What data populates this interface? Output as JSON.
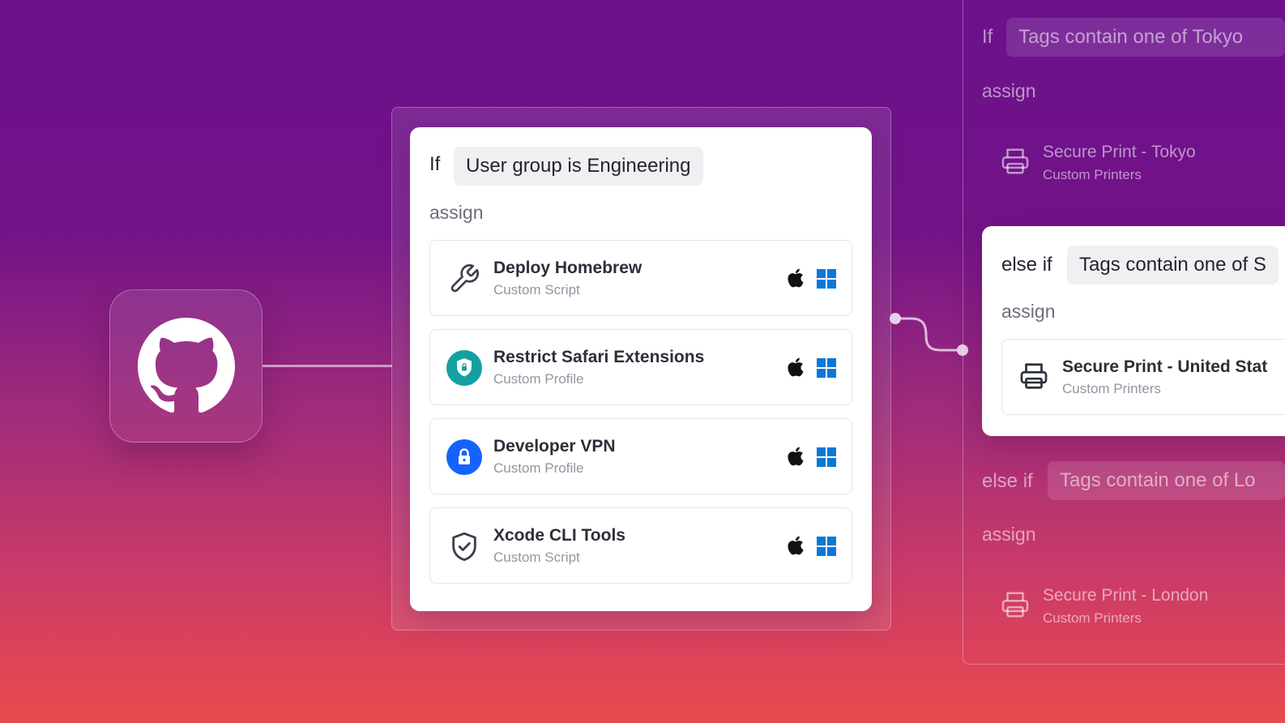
{
  "source": {
    "icon": "github-icon"
  },
  "rule": {
    "if_label": "If",
    "condition": "User group is Engineering",
    "assign_label": "assign",
    "items": [
      {
        "title": "Deploy Homebrew",
        "subtitle": "Custom Script",
        "icon": "wrench-icon"
      },
      {
        "title": "Restrict Safari Extensions",
        "subtitle": "Custom Profile",
        "icon": "shield-lock-badge-icon"
      },
      {
        "title": "Developer VPN",
        "subtitle": "Custom Profile",
        "icon": "lock-badge-icon"
      },
      {
        "title": "Xcode CLI Tools",
        "subtitle": "Custom Script",
        "icon": "shield-check-icon"
      }
    ],
    "platforms": [
      "apple-icon",
      "windows-icon"
    ]
  },
  "right_rules": {
    "top": {
      "if_label": "If",
      "condition": "Tags contain one of Tokyo",
      "assign_label": "assign",
      "item_title": "Secure Print - Tokyo",
      "item_subtitle": "Custom Printers"
    },
    "middle": {
      "else_if_label": "else if",
      "condition": "Tags contain one of S",
      "assign_label": "assign",
      "item_title": "Secure Print - United Stat",
      "item_subtitle": "Custom Printers"
    },
    "bottom": {
      "else_if_label": "else if",
      "condition": "Tags contain one of Lo",
      "assign_label": "assign",
      "item_title": "Secure Print - London",
      "item_subtitle": "Custom Printers"
    }
  },
  "colors": {
    "teal_badge": "#14a0a0",
    "blue_badge": "#1463ff",
    "windows_blue": "#0a78d7"
  }
}
